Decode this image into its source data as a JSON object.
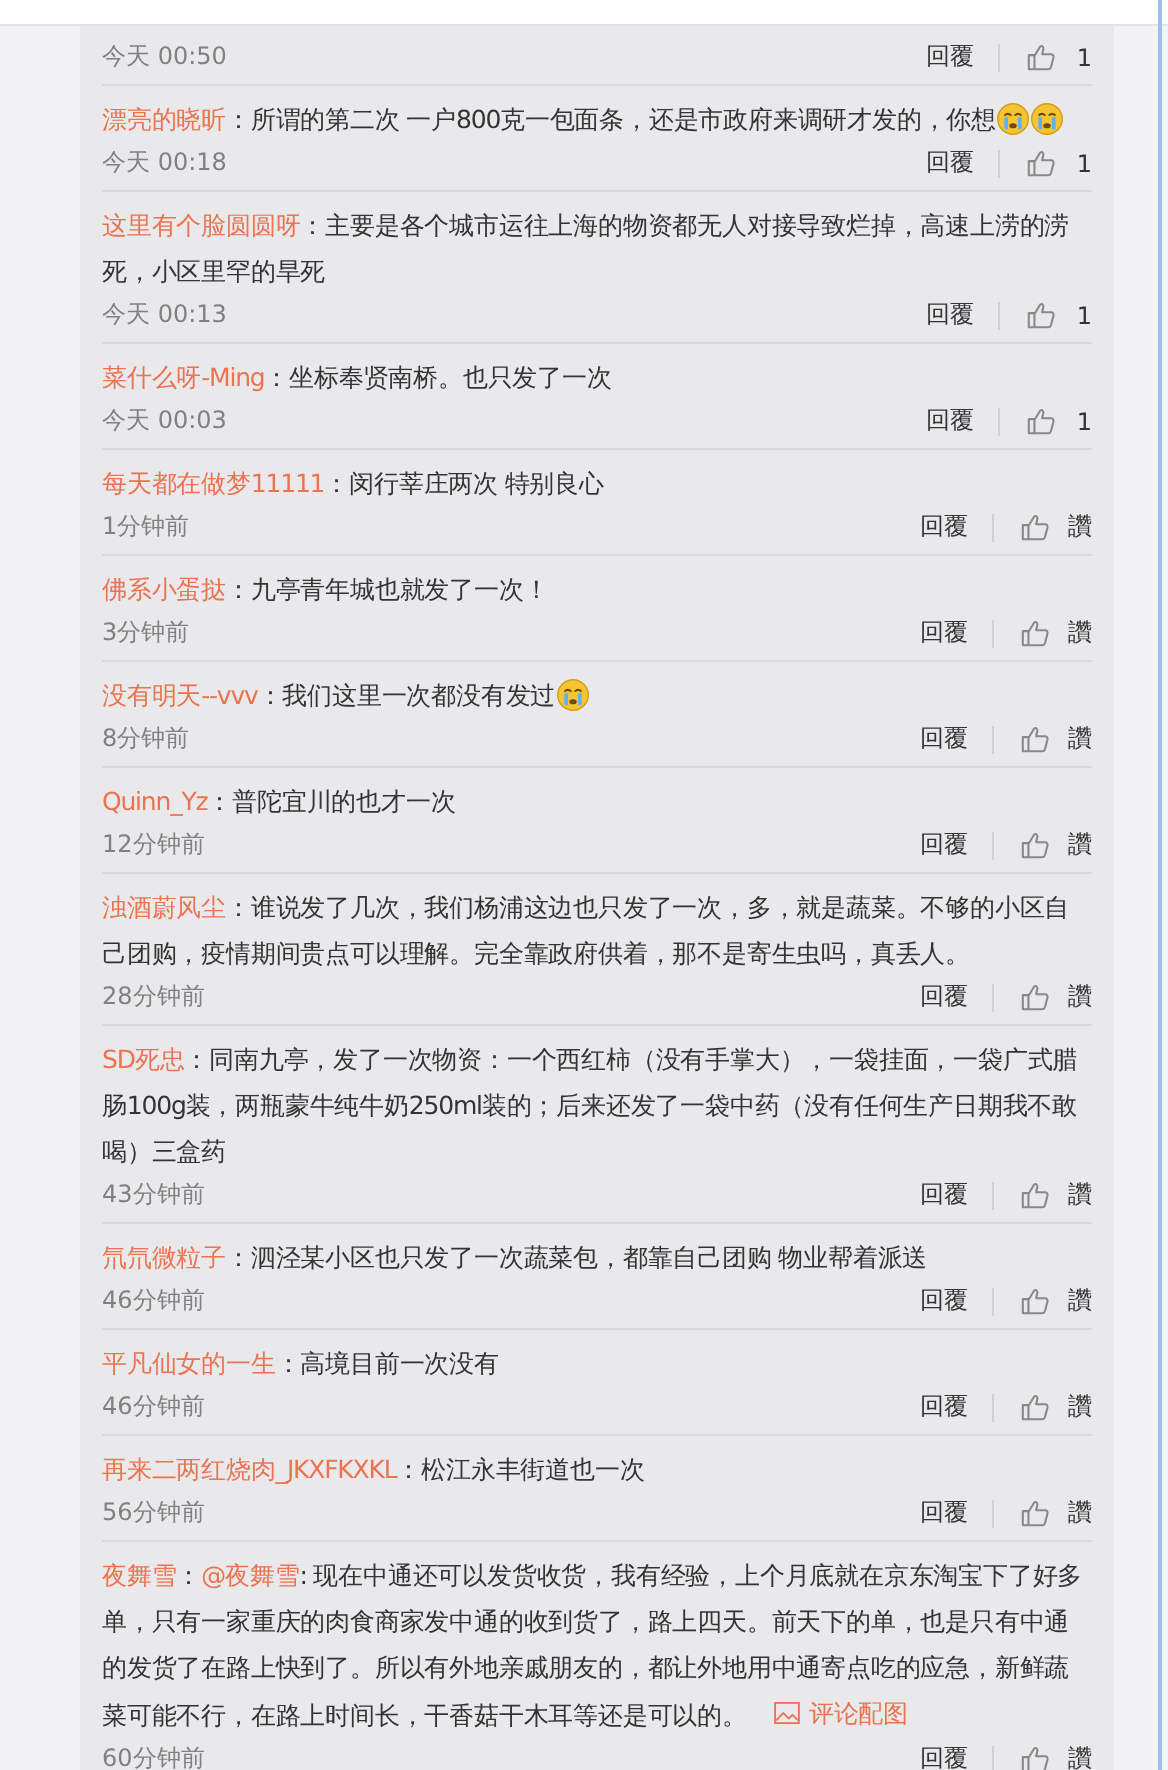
{
  "comments": [
    {
      "time": "今天 00:50",
      "reply": "回覆",
      "likes": "1"
    },
    {
      "user": "漂亮的晓昕",
      "content": [
        {
          "kind": "text",
          "text": "：所谓的第二次 一户800克一包面条，还是市政府来调研才发的，你想"
        },
        {
          "kind": "emoji"
        },
        {
          "kind": "emoji"
        }
      ],
      "time": "今天 00:18",
      "reply": "回覆",
      "likes": "1"
    },
    {
      "user": "这里有个脸圆圆呀",
      "content": [
        {
          "kind": "text",
          "text": "：主要是各个城市运往上海的物资都无人对接导致烂掉，高速上涝的涝死，小区里罕的旱死"
        }
      ],
      "time": "今天 00:13",
      "reply": "回覆",
      "likes": "1"
    },
    {
      "user": "菜什么呀-Ming",
      "content": [
        {
          "kind": "text",
          "text": "：坐标奉贤南桥。也只发了一次"
        }
      ],
      "time": "今天 00:03",
      "reply": "回覆",
      "likes": "1"
    },
    {
      "user": "每天都在做梦11111",
      "content": [
        {
          "kind": "text",
          "text": "：闵行莘庄两次 特别良心"
        }
      ],
      "time": "1分钟前",
      "reply": "回覆",
      "likes": "讚"
    },
    {
      "user": "佛系小蛋挞",
      "content": [
        {
          "kind": "text",
          "text": "：九亭青年城也就发了一次！"
        }
      ],
      "time": "3分钟前",
      "reply": "回覆",
      "likes": "讚"
    },
    {
      "user": "没有明天--vvv",
      "content": [
        {
          "kind": "text",
          "text": "：我们这里一次都没有发过"
        },
        {
          "kind": "emoji"
        }
      ],
      "time": "8分钟前",
      "reply": "回覆",
      "likes": "讚"
    },
    {
      "user": "Quinn_Yz",
      "content": [
        {
          "kind": "text",
          "text": "：普陀宜川的也才一次"
        }
      ],
      "time": "12分钟前",
      "reply": "回覆",
      "likes": "讚"
    },
    {
      "user": "浊酒蔚风尘",
      "content": [
        {
          "kind": "text",
          "text": "：谁说发了几次，我们杨浦这边也只发了一次，多，就是蔬菜。不够的小区自己团购，疫情期间贵点可以理解。完全靠政府供着，那不是寄生虫吗，真丢人。"
        }
      ],
      "time": "28分钟前",
      "reply": "回覆",
      "likes": "讚"
    },
    {
      "user": "SD死忠",
      "content": [
        {
          "kind": "text",
          "text": "：同南九亭，发了一次物资：一个西红柿（没有手掌大），一袋挂面，一袋广式腊肠100g装，两瓶蒙牛纯牛奶250ml装的；后来还发了一袋中药（没有任何生产日期我不敢喝）三盒药"
        }
      ],
      "time": "43分钟前",
      "reply": "回覆",
      "likes": "讚"
    },
    {
      "user": "氘氘微粒子",
      "content": [
        {
          "kind": "text",
          "text": "：泗泾某小区也只发了一次蔬菜包，都靠自己团购 物业帮着派送"
        }
      ],
      "time": "46分钟前",
      "reply": "回覆",
      "likes": "讚"
    },
    {
      "user": "平凡仙女的一生",
      "content": [
        {
          "kind": "text",
          "text": "：高境目前一次没有"
        }
      ],
      "time": "46分钟前",
      "reply": "回覆",
      "likes": "讚"
    },
    {
      "user": "再来二两红烧肉_JKXFKXKL",
      "content": [
        {
          "kind": "text",
          "text": "：松江永丰街道也一次"
        }
      ],
      "time": "56分钟前",
      "reply": "回覆",
      "likes": "讚"
    },
    {
      "user": "夜舞雪",
      "content": [
        {
          "kind": "text",
          "text": "："
        },
        {
          "kind": "mention",
          "text": "@夜舞雪"
        },
        {
          "kind": "text",
          "text": ": 现在中通还可以发货收货，我有经验，上个月底就在京东淘宝下了好多单，只有一家重庆的肉食商家发中通的收到货了，路上四天。前天下的单，也是只有中通的发货了在路上快到了。所以有外地亲戚朋友的，都让外地用中通寄点吃的应急，新鲜蔬菜可能不行，在路上时间长，干香菇干木耳等还是可以的。"
        },
        {
          "kind": "image_link",
          "text": "评论配图"
        }
      ],
      "time": "60分钟前",
      "reply": "回覆",
      "likes": "讚"
    }
  ]
}
